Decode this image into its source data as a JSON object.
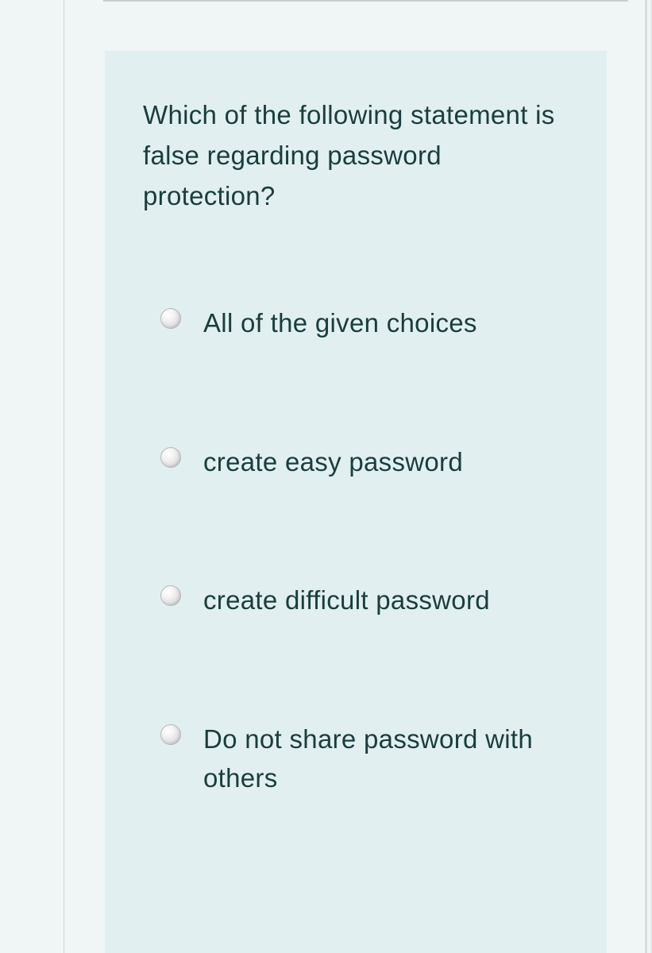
{
  "question": {
    "prompt": "Which of the following statement is false regarding password protection?",
    "options": [
      {
        "label": "All of the given choices"
      },
      {
        "label": "create easy password"
      },
      {
        "label": "create difficult password"
      },
      {
        "label": "Do not share password with others"
      }
    ]
  }
}
